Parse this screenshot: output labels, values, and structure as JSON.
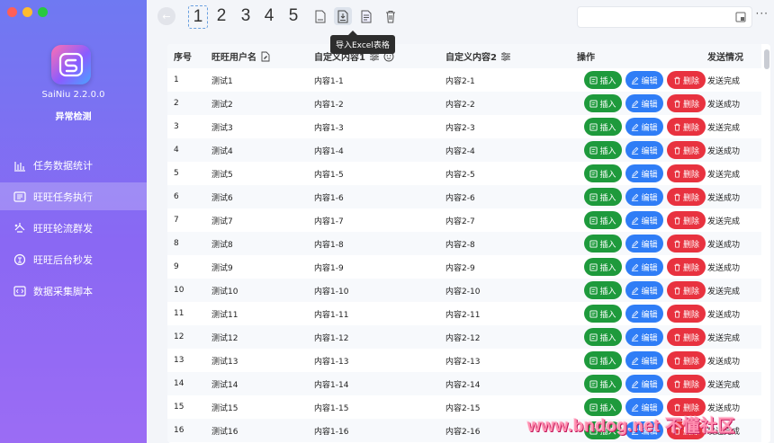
{
  "app": {
    "name": "SaiNiu 2.2.0.0",
    "subtitle": "异常检测",
    "colors": {
      "sidebar_top": "#6f79f2",
      "sidebar_bottom": "#9b6cf4",
      "insert": "#1e9a3c",
      "edit": "#2f7df6",
      "delete": "#e8323f"
    }
  },
  "window_controls": [
    {
      "name": "close",
      "color": "#ff5f57"
    },
    {
      "name": "minimize",
      "color": "#febc2e"
    },
    {
      "name": "maximize",
      "color": "#28c840"
    }
  ],
  "sidebar": {
    "items": [
      {
        "label": "任务数据统计",
        "icon": "bar-chart-icon",
        "active": false
      },
      {
        "label": "旺旺任务执行",
        "icon": "task-list-icon",
        "active": true
      },
      {
        "label": "旺旺轮流群发",
        "icon": "broadcast-icon",
        "active": false
      },
      {
        "label": "旺旺后台秒发",
        "icon": "background-send-icon",
        "active": false
      },
      {
        "label": "数据采集脚本",
        "icon": "code-script-icon",
        "active": false
      }
    ]
  },
  "toolbar": {
    "numbers": [
      "1",
      "2",
      "3",
      "4",
      "5"
    ],
    "selected_number": "1",
    "icons": [
      "csv-file-icon",
      "import-excel-icon",
      "export-file-icon",
      "trash-icon"
    ],
    "tooltip": "导入Excel表格",
    "more_label": "···"
  },
  "table": {
    "columns": {
      "index": "序号",
      "username": "旺旺用户名",
      "custom1": "自定义内容1",
      "custom2": "自定义内容2",
      "actions": "操作",
      "status": "发送情况"
    },
    "buttons": {
      "insert": "插入",
      "edit": "编辑",
      "delete": "删除"
    },
    "rows": [
      {
        "index": "1",
        "username": "测试1",
        "custom1": "内容1-1",
        "custom2": "内容2-1",
        "status": "发送完成"
      },
      {
        "index": "2",
        "username": "测试2",
        "custom1": "内容1-2",
        "custom2": "内容2-2",
        "status": "发送成功"
      },
      {
        "index": "3",
        "username": "测试3",
        "custom1": "内容1-3",
        "custom2": "内容2-3",
        "status": "发送完成"
      },
      {
        "index": "4",
        "username": "测试4",
        "custom1": "内容1-4",
        "custom2": "内容2-4",
        "status": "发送成功"
      },
      {
        "index": "5",
        "username": "测试5",
        "custom1": "内容1-5",
        "custom2": "内容2-5",
        "status": "发送完成"
      },
      {
        "index": "6",
        "username": "测试6",
        "custom1": "内容1-6",
        "custom2": "内容2-6",
        "status": "发送成功"
      },
      {
        "index": "7",
        "username": "测试7",
        "custom1": "内容1-7",
        "custom2": "内容2-7",
        "status": "发送完成"
      },
      {
        "index": "8",
        "username": "测试8",
        "custom1": "内容1-8",
        "custom2": "内容2-8",
        "status": "发送成功"
      },
      {
        "index": "9",
        "username": "测试9",
        "custom1": "内容1-9",
        "custom2": "内容2-9",
        "status": "发送成功"
      },
      {
        "index": "10",
        "username": "测试10",
        "custom1": "内容1-10",
        "custom2": "内容2-10",
        "status": "发送完成"
      },
      {
        "index": "11",
        "username": "测试11",
        "custom1": "内容1-11",
        "custom2": "内容2-11",
        "status": "发送成功"
      },
      {
        "index": "12",
        "username": "测试12",
        "custom1": "内容1-12",
        "custom2": "内容2-12",
        "status": "发送完成"
      },
      {
        "index": "13",
        "username": "测试13",
        "custom1": "内容1-13",
        "custom2": "内容2-13",
        "status": "发送成功"
      },
      {
        "index": "14",
        "username": "测试14",
        "custom1": "内容1-14",
        "custom2": "内容2-14",
        "status": "发送完成"
      },
      {
        "index": "15",
        "username": "测试15",
        "custom1": "内容1-15",
        "custom2": "内容2-15",
        "status": "发送成功"
      },
      {
        "index": "16",
        "username": "测试16",
        "custom1": "内容1-16",
        "custom2": "内容2-16",
        "status": "发送完成"
      }
    ]
  },
  "watermark": "www.bndog.net 不懂社区"
}
